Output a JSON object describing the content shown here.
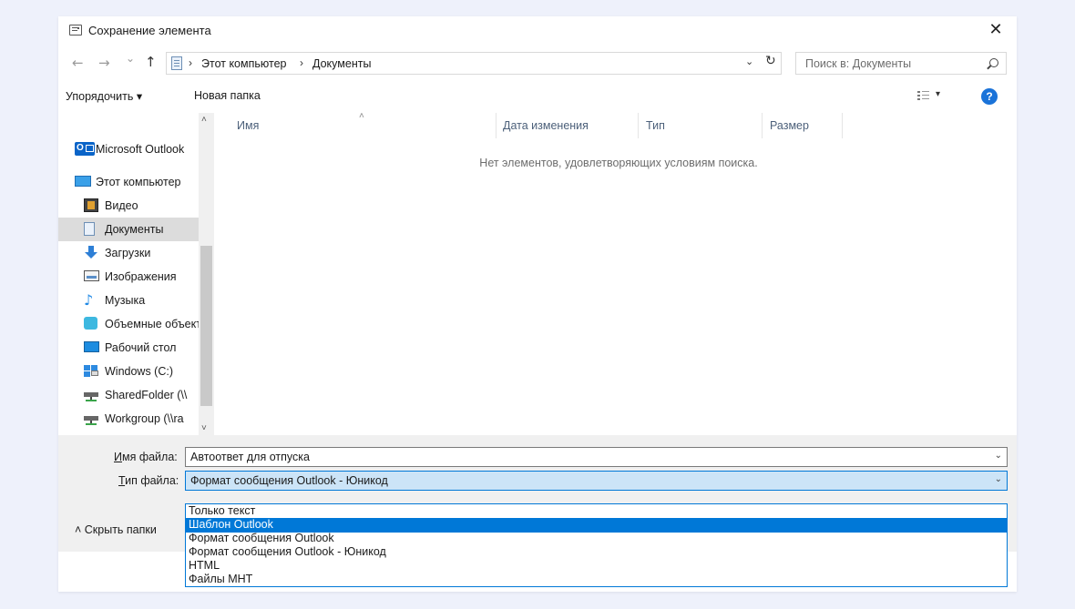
{
  "window": {
    "title": "Сохранение элемента",
    "close_glyph": "✕"
  },
  "nav": {
    "back": "←",
    "forward": "→",
    "recent": "⌄",
    "up": "↑",
    "breadcrumbs": [
      "Этот компьютер",
      "Документы"
    ],
    "crumb_sep": "›",
    "dropdown_glyph": "⌄",
    "refresh_glyph": "↻",
    "search_placeholder": "Поиск в: Документы"
  },
  "toolbar": {
    "organize": "Упорядочить ▾",
    "new_folder": "Новая папка",
    "view_drop": "▾",
    "help": "?"
  },
  "sidebar": {
    "items": [
      {
        "label": "Microsoft Outlook",
        "icon": "outlook-icon"
      },
      {
        "label": "Этот компьютер",
        "icon": "computer-icon"
      },
      {
        "label": "Видео",
        "icon": "video-icon"
      },
      {
        "label": "Документы",
        "icon": "documents-icon"
      },
      {
        "label": "Загрузки",
        "icon": "downloads-icon"
      },
      {
        "label": "Изображения",
        "icon": "images-icon"
      },
      {
        "label": "Музыка",
        "icon": "music-icon"
      },
      {
        "label": "Объемные объекты",
        "icon": "3d-objects-icon"
      },
      {
        "label": "Рабочий стол",
        "icon": "desktop-icon"
      },
      {
        "label": "Windows (C:)",
        "icon": "drive-icon"
      },
      {
        "label": "SharedFolder (\\\\",
        "icon": "network-drive-icon"
      },
      {
        "label": "Workgroup (\\\\ra",
        "icon": "network-drive-icon"
      }
    ],
    "scroll_up": "˄",
    "scroll_down": "˅"
  },
  "columns": {
    "name": "Имя",
    "date": "Дата изменения",
    "type": "Тип",
    "size": "Размер",
    "sort_glyph": "˄"
  },
  "empty_message": "Нет элементов, удовлетворяющих условиям поиска.",
  "filename": {
    "label_key": "И",
    "label_rest": "мя файла:",
    "value": "Автоответ для отпуска"
  },
  "filetype": {
    "label_key": "Т",
    "label_rest": "ип файла:",
    "value": "Формат сообщения Outlook - Юникод",
    "options": [
      "Только текст",
      "Шаблон Outlook",
      "Формат сообщения Outlook",
      "Формат сообщения Outlook - Юникод",
      "HTML",
      "Файлы MHT"
    ],
    "selected_option": 1
  },
  "hide_folders": "˄  Скрыть папки",
  "colors": {
    "accent": "#0078d7",
    "selected_bg": "#cce4f7",
    "help": "#1a73d9"
  }
}
